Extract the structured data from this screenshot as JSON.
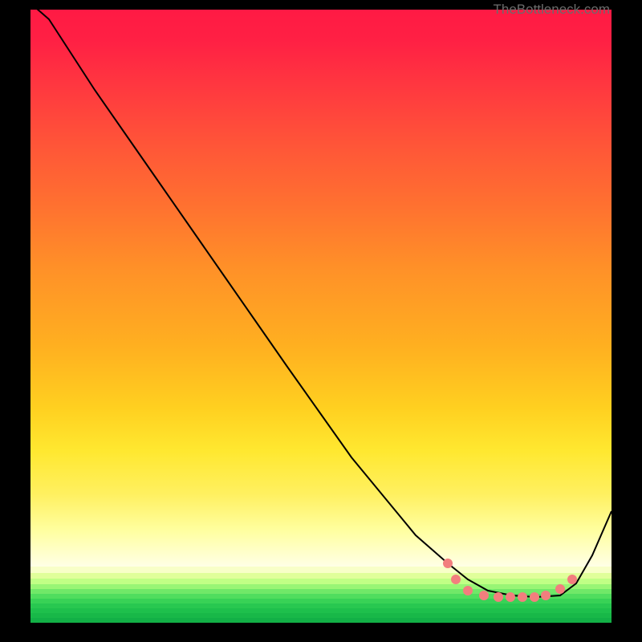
{
  "watermark": "TheBottleneck.com",
  "chart_data": {
    "type": "line",
    "title": "",
    "xlabel": "",
    "ylabel": "",
    "series": [
      {
        "name": "curve",
        "x": [
          0,
          23,
          80,
          160,
          240,
          320,
          400,
          480,
          520,
          545,
          570,
          600,
          630,
          660,
          680,
          700,
          724
        ],
        "y": [
          -8,
          12,
          100,
          215,
          330,
          445,
          558,
          655,
          690,
          710,
          724,
          730,
          732,
          730,
          715,
          680,
          625
        ]
      }
    ],
    "markers": {
      "x": [
        520,
        530,
        545,
        565,
        583,
        598,
        613,
        628,
        642,
        660,
        675
      ],
      "y": [
        690,
        710,
        724,
        730,
        732,
        732,
        732,
        732,
        730,
        722,
        710
      ],
      "color": "#F27E7E"
    },
    "bottom_stripes": [
      {
        "color": "#F8FFC8",
        "h": 8
      },
      {
        "color": "#E0FF9A",
        "h": 7
      },
      {
        "color": "#C0FF85",
        "h": 7
      },
      {
        "color": "#98F575",
        "h": 6
      },
      {
        "color": "#70E868",
        "h": 6
      },
      {
        "color": "#50DD5E",
        "h": 6
      },
      {
        "color": "#38D256",
        "h": 6
      },
      {
        "color": "#28C850",
        "h": 6
      },
      {
        "color": "#1EC04C",
        "h": 6
      },
      {
        "color": "#18B848",
        "h": 6
      },
      {
        "color": "#12B046",
        "h": 6
      }
    ]
  },
  "colors": {
    "marker": "#F27E7E",
    "curve": "#000000"
  }
}
